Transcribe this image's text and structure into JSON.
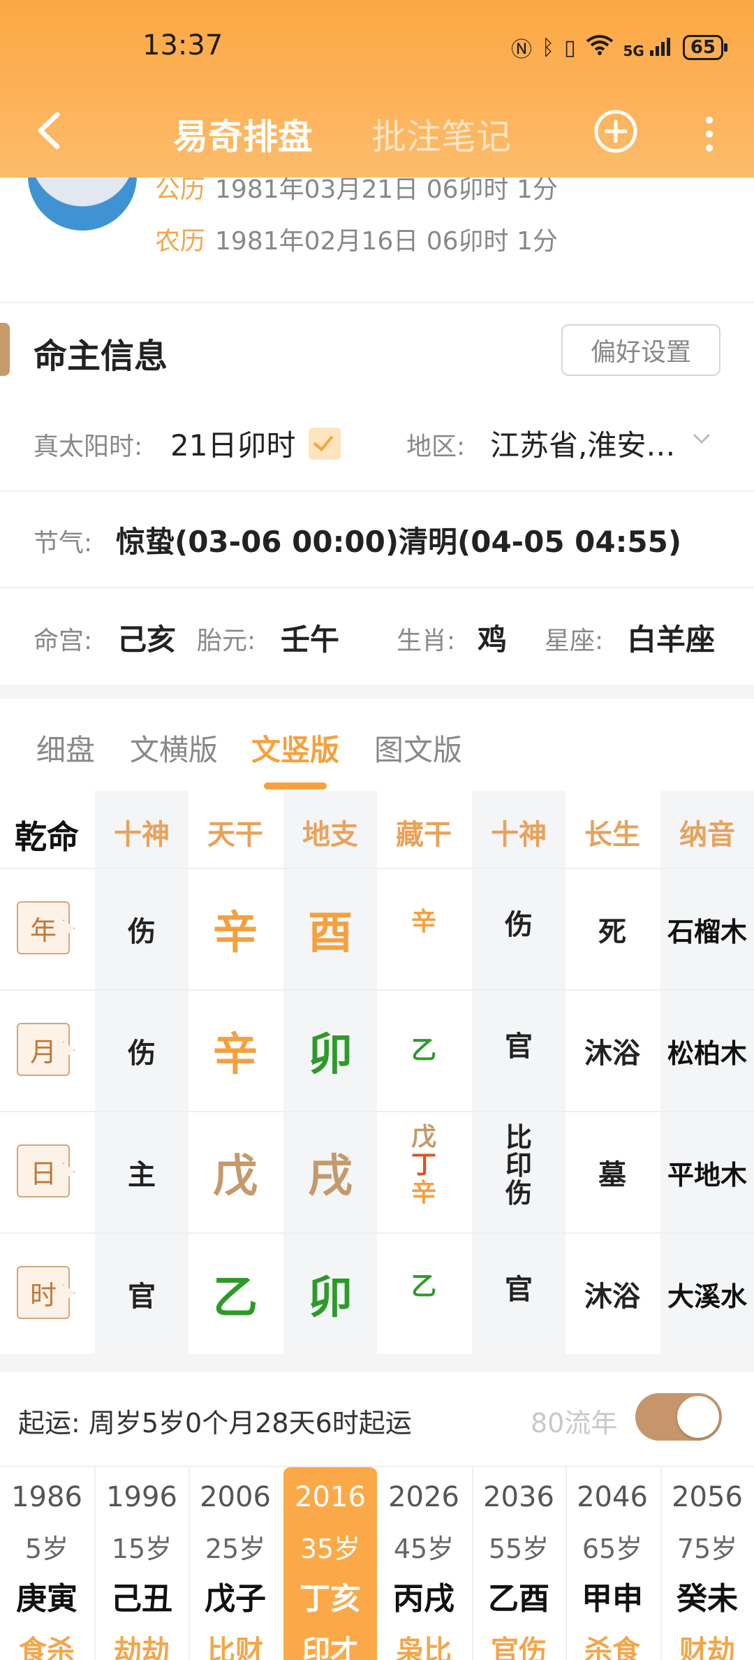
{
  "status_bar": {
    "time": "13:37",
    "network": "5G",
    "battery": "65"
  },
  "nav": {
    "tab_active": "易奇排盘",
    "tab_inactive": "批注笔记"
  },
  "profile": {
    "solar_label": "公历",
    "solar_value": "1981年03月21日 06卯时 1分",
    "lunar_label": "农历",
    "lunar_value": "1981年02月16日 06卯时 1分"
  },
  "section": {
    "title": "命主信息",
    "pref_button": "偏好设置"
  },
  "info": {
    "solar_time_label": "真太阳时:",
    "solar_time_value": "21日卯时",
    "region_label": "地区:",
    "region_value": "江苏省,淮安…",
    "jieqi_label": "节气:",
    "jieqi_value": "惊蛰(03-06 00:00)清明(04-05 04:55)",
    "minggong_label": "命宫:",
    "minggong_value": "己亥",
    "taiyuan_label": "胎元:",
    "taiyuan_value": "壬午",
    "shengxiao_label": "生肖:",
    "shengxiao_value": "鸡",
    "xingzuo_label": "星座:",
    "xingzuo_value": "白羊座"
  },
  "view_tabs": [
    "细盘",
    "文横版",
    "文竖版",
    "图文版"
  ],
  "table": {
    "corner": "乾命",
    "headers": [
      "十神",
      "天干",
      "地支",
      "藏干",
      "十神",
      "长生",
      "纳音"
    ],
    "rows": [
      {
        "pillar": "年",
        "shishen": "伤",
        "gan": "辛",
        "zhi": "酉",
        "zanggan": [
          "辛"
        ],
        "zang_shishen": [
          "伤"
        ],
        "changsheng": "死",
        "nayin": "石榴木"
      },
      {
        "pillar": "月",
        "shishen": "伤",
        "gan": "辛",
        "zhi": "卯",
        "zanggan": [
          "乙"
        ],
        "zang_shishen": [
          "官"
        ],
        "changsheng": "沐浴",
        "nayin": "松柏木"
      },
      {
        "pillar": "日",
        "shishen": "主",
        "gan": "戊",
        "zhi": "戌",
        "zanggan": [
          "戊",
          "丁",
          "辛"
        ],
        "zang_shishen": [
          "比",
          "印",
          "伤"
        ],
        "changsheng": "墓",
        "nayin": "平地木"
      },
      {
        "pillar": "时",
        "shishen": "官",
        "gan": "乙",
        "zhi": "卯",
        "zanggan": [
          "乙"
        ],
        "zang_shishen": [
          "官"
        ],
        "changsheng": "沐浴",
        "nayin": "大溪水"
      }
    ],
    "colors": {
      "metal": "#f5a040",
      "earth": "#c49a6c",
      "wood": "#2e9a2a",
      "fire": "#e0501e",
      "header": "#e8a25a"
    }
  },
  "qiyun": {
    "text": "起运: 周岁5岁0个月28天6时起运",
    "liunian_label": "80流年",
    "toggle_on": true
  },
  "dayun": [
    {
      "year": "1986",
      "age": "5岁",
      "ganzhi": "庚寅",
      "shishen": "食杀",
      "active": false
    },
    {
      "year": "1996",
      "age": "15岁",
      "ganzhi": "己丑",
      "shishen": "劫劫",
      "active": false
    },
    {
      "year": "2006",
      "age": "25岁",
      "ganzhi": "戊子",
      "shishen": "比财",
      "active": false
    },
    {
      "year": "2016",
      "age": "35岁",
      "ganzhi": "丁亥",
      "shishen": "印才",
      "active": true
    },
    {
      "year": "2026",
      "age": "45岁",
      "ganzhi": "丙戌",
      "shishen": "枭比",
      "active": false
    },
    {
      "year": "2036",
      "age": "55岁",
      "ganzhi": "乙酉",
      "shishen": "官伤",
      "active": false
    },
    {
      "year": "2046",
      "age": "65岁",
      "ganzhi": "甲申",
      "shishen": "杀食",
      "active": false
    },
    {
      "year": "2056",
      "age": "75岁",
      "ganzhi": "癸未",
      "shishen": "财劫",
      "active": false
    }
  ]
}
